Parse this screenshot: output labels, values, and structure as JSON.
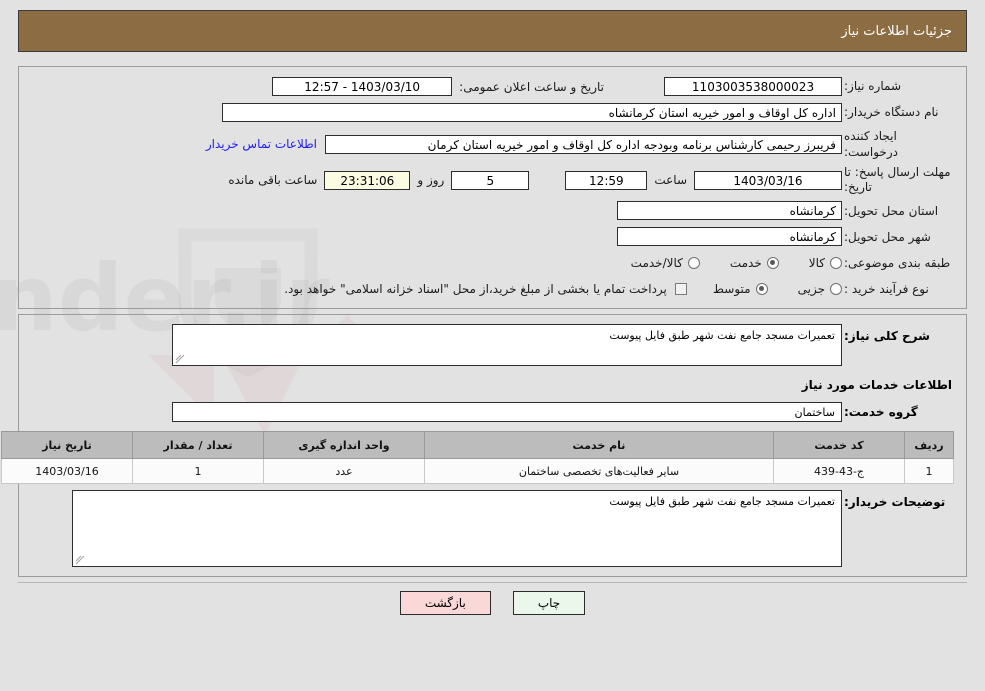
{
  "header": {
    "title": "جزئیات اطلاعات نیاز"
  },
  "fields": {
    "need_no_label": "شماره نیاز:",
    "need_no_value": "1103003538000023",
    "public_date_label": "تاریخ و ساعت اعلان عمومی:",
    "public_date_value": "1403/03/10 - 12:57",
    "buyer_org_label": "نام دستگاه خریدار:",
    "buyer_org_value": "اداره کل اوقاف و امور خیریه استان کرمانشاه",
    "creator_label": "ایجاد کننده درخواست:",
    "creator_value": "فریبرز رحیمی کارشناس برنامه وبودجه اداره کل اوقاف و امور خیریه استان کرمان",
    "contact_link": "اطلاعات تماس خریدار",
    "deadline_label": "مهلت ارسال پاسخ: تا تاریخ:",
    "deadline_date": "1403/03/16",
    "hour_label": "ساعت",
    "deadline_time": "12:59",
    "days_remaining": "5",
    "day_and_label": "روز و",
    "countdown": "23:31:06",
    "remaining_suffix": "ساعت باقی مانده",
    "province_label": "استان محل تحویل:",
    "province_value": "کرمانشاه",
    "city_label": "شهر محل تحویل:",
    "city_value": "کرمانشاه"
  },
  "classification": {
    "label": "طبقه بندی موضوعی:",
    "options": [
      {
        "label": "کالا",
        "selected": false
      },
      {
        "label": "خدمت",
        "selected": true
      },
      {
        "label": "کالا/خدمت",
        "selected": false
      }
    ]
  },
  "purchase_type": {
    "label": "نوع فرآیند خرید :",
    "options": [
      {
        "label": "جزیی",
        "selected": false
      },
      {
        "label": "متوسط",
        "selected": true
      }
    ],
    "checkbox_checked": false,
    "note": "پرداخت تمام یا بخشی از مبلغ خرید،از محل \"اسناد خزانه اسلامی\" خواهد بود."
  },
  "description": {
    "label": "شرح کلی نیاز:",
    "value": "تعمیرات مسجد جامع نفت شهر طبق فایل پیوست"
  },
  "services_section": {
    "title": "اطلاعات خدمات مورد نیاز",
    "group_label": "گروه خدمت:",
    "group_value": "ساختمان"
  },
  "table": {
    "headers": [
      "ردیف",
      "کد خدمت",
      "نام خدمت",
      "واحد اندازه گیری",
      "تعداد / مقدار",
      "تاریخ نیاز"
    ],
    "rows": [
      {
        "row_no": "1",
        "code": "ج-43-439",
        "name": "سایر فعالیت‌های تخصصی ساختمان",
        "unit": "عدد",
        "qty": "1",
        "need_date": "1403/03/16"
      }
    ]
  },
  "comments": {
    "label": "توضیحات خریدار:",
    "value": "تعمیرات مسجد جامع نفت شهر طبق فایل پیوست"
  },
  "footer": {
    "print_label": "چاپ",
    "back_label": "بازگشت"
  },
  "colors": {
    "header_band": "#8c6c42",
    "link": "#2020ee",
    "table_header": "#bcbcbc",
    "print_button": "#eaf7ea",
    "back_button": "#fbd8d8",
    "countdown_field": "#fbfbe2"
  }
}
